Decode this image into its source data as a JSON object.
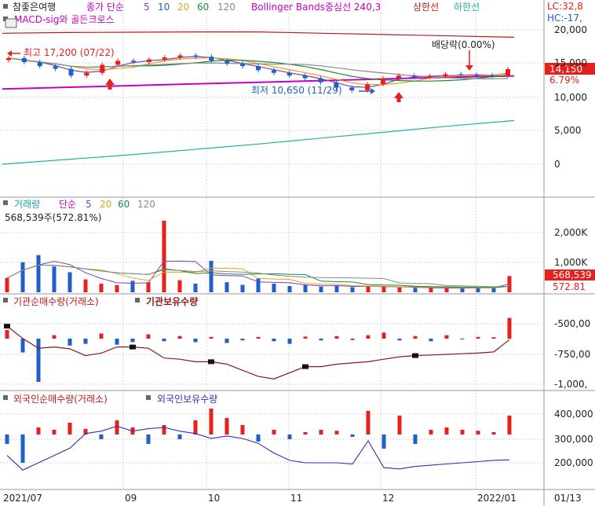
{
  "header": {
    "stock_name": "참좋은여행",
    "price_label": "종가 단순",
    "ma_periods": [
      "5",
      "10",
      "20",
      "60",
      "120"
    ],
    "bollinger_label": "Bollinger Bands중심선 240,3",
    "upper_band_label": "상한선",
    "lower_band_label": "하한선",
    "macd_label": "MACD-sig와 골든크로스",
    "lc_label": "LC:32,8",
    "hc_label": "HC:-17,"
  },
  "price_panel": {
    "high_annotation": "최고 17,200 (07/22)",
    "low_annotation": "최저 10,650 (11/29)",
    "dividend_annotation": "배당락(0.00%)",
    "current_price": "14,150",
    "change_pct": "6.79%",
    "y_ticks": [
      "20,000",
      "15,000",
      "10,000",
      "5,000",
      "0"
    ]
  },
  "volume_panel": {
    "title": "거래량",
    "ma_label": "단순",
    "ma_periods": [
      "5",
      "20",
      "60",
      "120"
    ],
    "last_volume": "568,539주(572.81%)",
    "current_value": "568,539",
    "current_pct": "572.81",
    "y_ticks": [
      "2,000K",
      "1,000K"
    ]
  },
  "inst_panel": {
    "net_label": "기관순매수량(거래소)",
    "hold_label": "기관보유수량",
    "y_ticks": [
      "-500,00",
      "-750,00",
      "-1,000,"
    ]
  },
  "foreign_panel": {
    "net_label": "외국인순매수량(거래소)",
    "hold_label": "외국인보유수량",
    "y_ticks": [
      "400,000",
      "300,000",
      "200,000"
    ]
  },
  "date_axis": [
    "2021/07",
    "09",
    "10",
    "11",
    "12",
    "2022/01",
    "01/13"
  ],
  "colors": {
    "up": "#e8201c",
    "down": "#1f5fc8",
    "ma5": "#7b3fbf",
    "ma10": "#1f5fc8",
    "ma20": "#e8a317",
    "ma60": "#1a8a3a",
    "ma120": "#888888",
    "bollinger_mid": "#c800c8",
    "bollinger_upper": "#c01818",
    "bollinger_lower": "#1fb0a8",
    "inst_hold": "#8b1a1a",
    "foreign_hold": "#3030b0"
  },
  "chart_data": [
    {
      "type": "candlestick",
      "title": "참좋은여행",
      "x": [
        "2021/07",
        "09",
        "10",
        "11",
        "12",
        "2022/01"
      ],
      "ylim": [
        -2000,
        21000
      ],
      "high": {
        "label": "최고",
        "value": 17200,
        "date": "07/22"
      },
      "low": {
        "label": "최저",
        "value": 10650,
        "date": "11/29"
      },
      "last_close": 14150,
      "close": [
        15800,
        15200,
        14600,
        14200,
        13200,
        13600,
        14800,
        15400,
        15200,
        15600,
        15900,
        16200,
        16000,
        15400,
        15000,
        14600,
        14000,
        13600,
        13200,
        12800,
        12200,
        11400,
        11000,
        11900,
        12800,
        13200,
        13000,
        13100,
        13400,
        13300,
        13250,
        13200,
        14150
      ],
      "series": [
        {
          "name": "Bollinger Bands중심선 240,3",
          "values": [
            11200,
            11450,
            11700,
            11950,
            12200,
            12450,
            12700,
            12950,
            13150
          ]
        },
        {
          "name": "상한선",
          "values": [
            19500,
            19600,
            19650,
            19700,
            19700,
            19500,
            19300,
            19100,
            18900
          ]
        },
        {
          "name": "하한선",
          "values": [
            0,
            700,
            1400,
            2200,
            3000,
            3900,
            4800,
            5700,
            6500
          ]
        }
      ]
    },
    {
      "type": "bar",
      "title": "거래량",
      "ylim": [
        0,
        2800000
      ],
      "last_value": 568539,
      "values": [
        500000,
        1050000,
        1300000,
        900000,
        700000,
        450000,
        300000,
        250000,
        400000,
        350000,
        2500000,
        420000,
        300000,
        1100000,
        350000,
        260000,
        480000,
        300000,
        220000,
        260000,
        200000,
        240000,
        180000,
        210000,
        200000,
        170000,
        160000,
        150000,
        140000,
        150000,
        160000,
        150000,
        568539
      ]
    },
    {
      "type": "bar",
      "title": "기관순매수량(거래소)",
      "series": [
        {
          "name": "기관순매수량(거래소)",
          "values": [
            50000,
            -80000,
            -250000,
            20000,
            -40000,
            -30000,
            30000,
            -35000,
            -20000,
            25000,
            -15000,
            15000,
            -20000,
            10000,
            -25000,
            -10000,
            10000,
            -15000,
            -30000,
            12000,
            -10000,
            15000,
            -8000,
            20000,
            35000,
            -10000,
            15000,
            -15000,
            20000,
            -5000,
            10000,
            8000,
            120000
          ]
        },
        {
          "name": "기관보유수량",
          "values": [
            -520000,
            -620000,
            -700000,
            -690000,
            -705000,
            -760000,
            -740000,
            -690000,
            -690000,
            -700000,
            -780000,
            -790000,
            -810000,
            -810000,
            -830000,
            -880000,
            -930000,
            -950000,
            -900000,
            -850000,
            -850000,
            -830000,
            -820000,
            -810000,
            -790000,
            -770000,
            -760000,
            -755000,
            -750000,
            -745000,
            -740000,
            -730000,
            -630000
          ]
        }
      ]
    },
    {
      "type": "bar",
      "title": "외국인순매수량(거래소)",
      "series": [
        {
          "name": "외국인순매수량(거래소)",
          "values": [
            -20000,
            -60000,
            15000,
            10000,
            25000,
            12000,
            -10000,
            30000,
            15000,
            -20000,
            20000,
            -10000,
            30000,
            55000,
            35000,
            20000,
            -15000,
            10000,
            -10000,
            5000,
            10000,
            8000,
            -5000,
            50000,
            -30000,
            40000,
            -20000,
            10000,
            15000,
            10000,
            8000,
            5000,
            40000
          ]
        },
        {
          "name": "외국인보유수량",
          "values": [
            230000,
            170000,
            200000,
            230000,
            260000,
            320000,
            330000,
            350000,
            330000,
            340000,
            345000,
            330000,
            320000,
            300000,
            310000,
            300000,
            280000,
            240000,
            210000,
            200000,
            200000,
            200000,
            195000,
            290000,
            180000,
            175000,
            185000,
            190000,
            195000,
            200000,
            205000,
            210000,
            212000
          ]
        }
      ]
    }
  ]
}
